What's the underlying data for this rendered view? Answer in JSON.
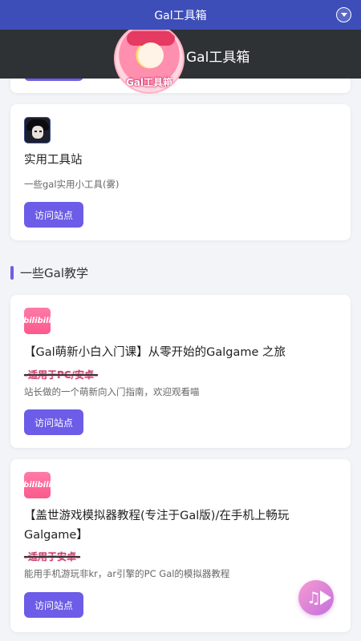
{
  "topbar": {
    "title": "Gal工具箱"
  },
  "header": {
    "title": "Gal工具箱",
    "logo_text": "Gal工具箱"
  },
  "section": {
    "heading": "一些Gal教学"
  },
  "cards": [
    {
      "icon": "avatar-icon",
      "title": "实用工具站",
      "desc": "一些gal实用小工具(雾)",
      "button": "访问站点"
    },
    {
      "icon": "bilibili-icon",
      "icon_text": "bilibili",
      "title": "【Gal萌新小白入门课】从零开始的Galgame 之旅",
      "tag": "-适用于PC/安卓-",
      "desc": "站长做的一个萌新向入门指南，欢迎观看喵",
      "button": "访问站点"
    },
    {
      "icon": "bilibili-icon",
      "icon_text": "bilibili",
      "title": "【盖世游戏模拟器教程(专注于Gal版)/在手机上畅玩Galgame】",
      "tag": "-适用于安卓-",
      "desc": "能用手机游玩非kr，ar引擎的PC Gal的模拟器教程",
      "button": "访问站点"
    }
  ],
  "colors": {
    "accent": "#6c5ce7",
    "topbar": "#3d4eb8",
    "header": "#2e3235"
  }
}
